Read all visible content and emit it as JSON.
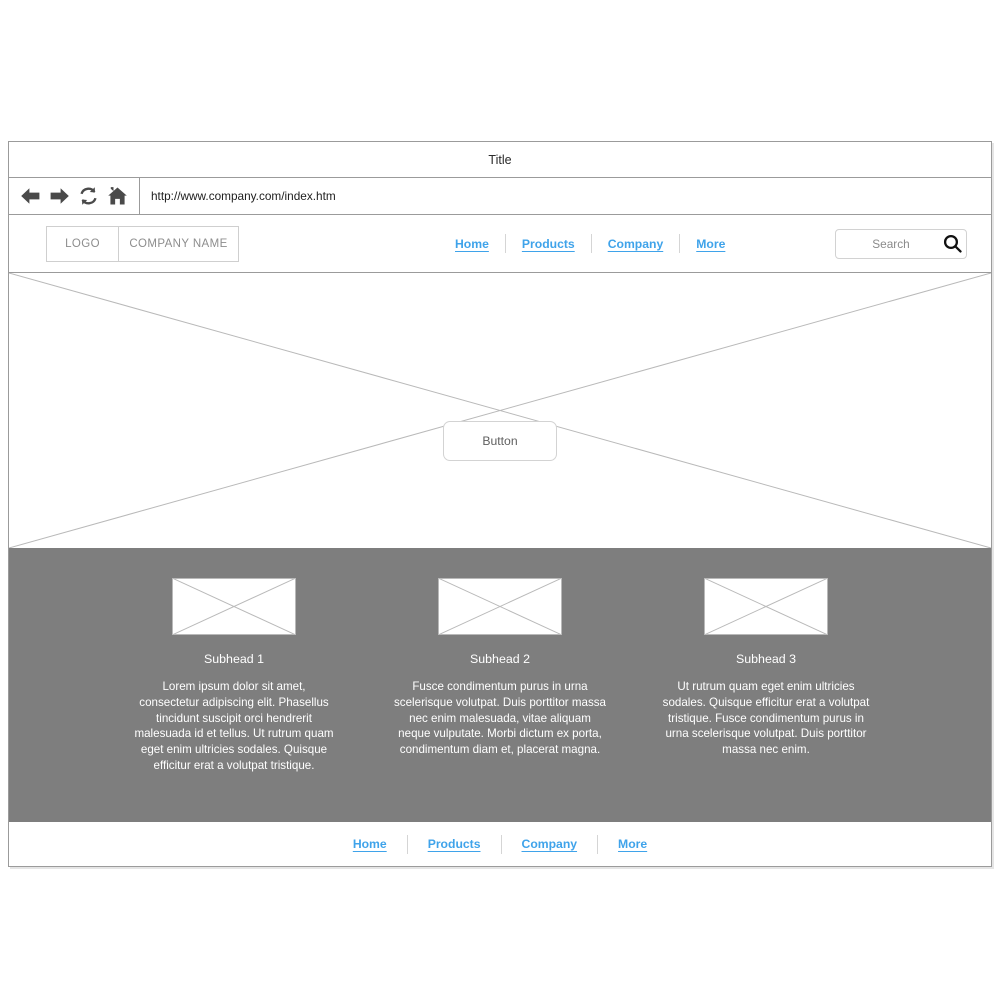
{
  "browser": {
    "title": "Title",
    "url": "http://www.company.com/index.htm",
    "icons": [
      {
        "name": "back-arrow-icon",
        "label": "Back"
      },
      {
        "name": "forward-arrow-icon",
        "label": "Forward"
      },
      {
        "name": "refresh-icon",
        "label": "Refresh"
      },
      {
        "name": "home-icon",
        "label": "Home"
      }
    ]
  },
  "header": {
    "logo_label": "LOGO",
    "company_label": "COMPANY NAME",
    "nav": [
      {
        "label": "Home"
      },
      {
        "label": "Products"
      },
      {
        "label": "Company"
      },
      {
        "label": "More"
      }
    ],
    "search": {
      "placeholder": "Search",
      "icon": "search-icon"
    }
  },
  "hero": {
    "placeholder_type": "image-placeholder-cross",
    "button_label": "Button"
  },
  "features": [
    {
      "subhead": "Subhead 1",
      "body": "Lorem ipsum dolor sit amet, consectetur adipiscing elit. Phasellus tincidunt suscipit orci hendrerit malesuada id et tellus. Ut rutrum quam eget enim ultricies sodales. Quisque efficitur erat a volutpat tristique."
    },
    {
      "subhead": "Subhead 2",
      "body": "Fusce condimentum purus in urna scelerisque volutpat. Duis porttitor massa nec enim malesuada, vitae aliquam neque vulputate. Morbi dictum ex porta, condimentum diam et, placerat magna."
    },
    {
      "subhead": "Subhead 3",
      "body": "Ut rutrum quam eget enim ultricies sodales. Quisque efficitur erat a volutpat tristique. Fusce condimentum purus in urna scelerisque volutpat. Duis porttitor massa nec enim."
    }
  ],
  "footer": {
    "nav": [
      {
        "label": "Home"
      },
      {
        "label": "Products"
      },
      {
        "label": "Company"
      },
      {
        "label": "More"
      }
    ]
  },
  "colors": {
    "link": "#3fa3ea",
    "feature_background": "#7e7e7e",
    "frame_border": "#9b9b9b",
    "placeholder_line": "#b9b9b9"
  }
}
